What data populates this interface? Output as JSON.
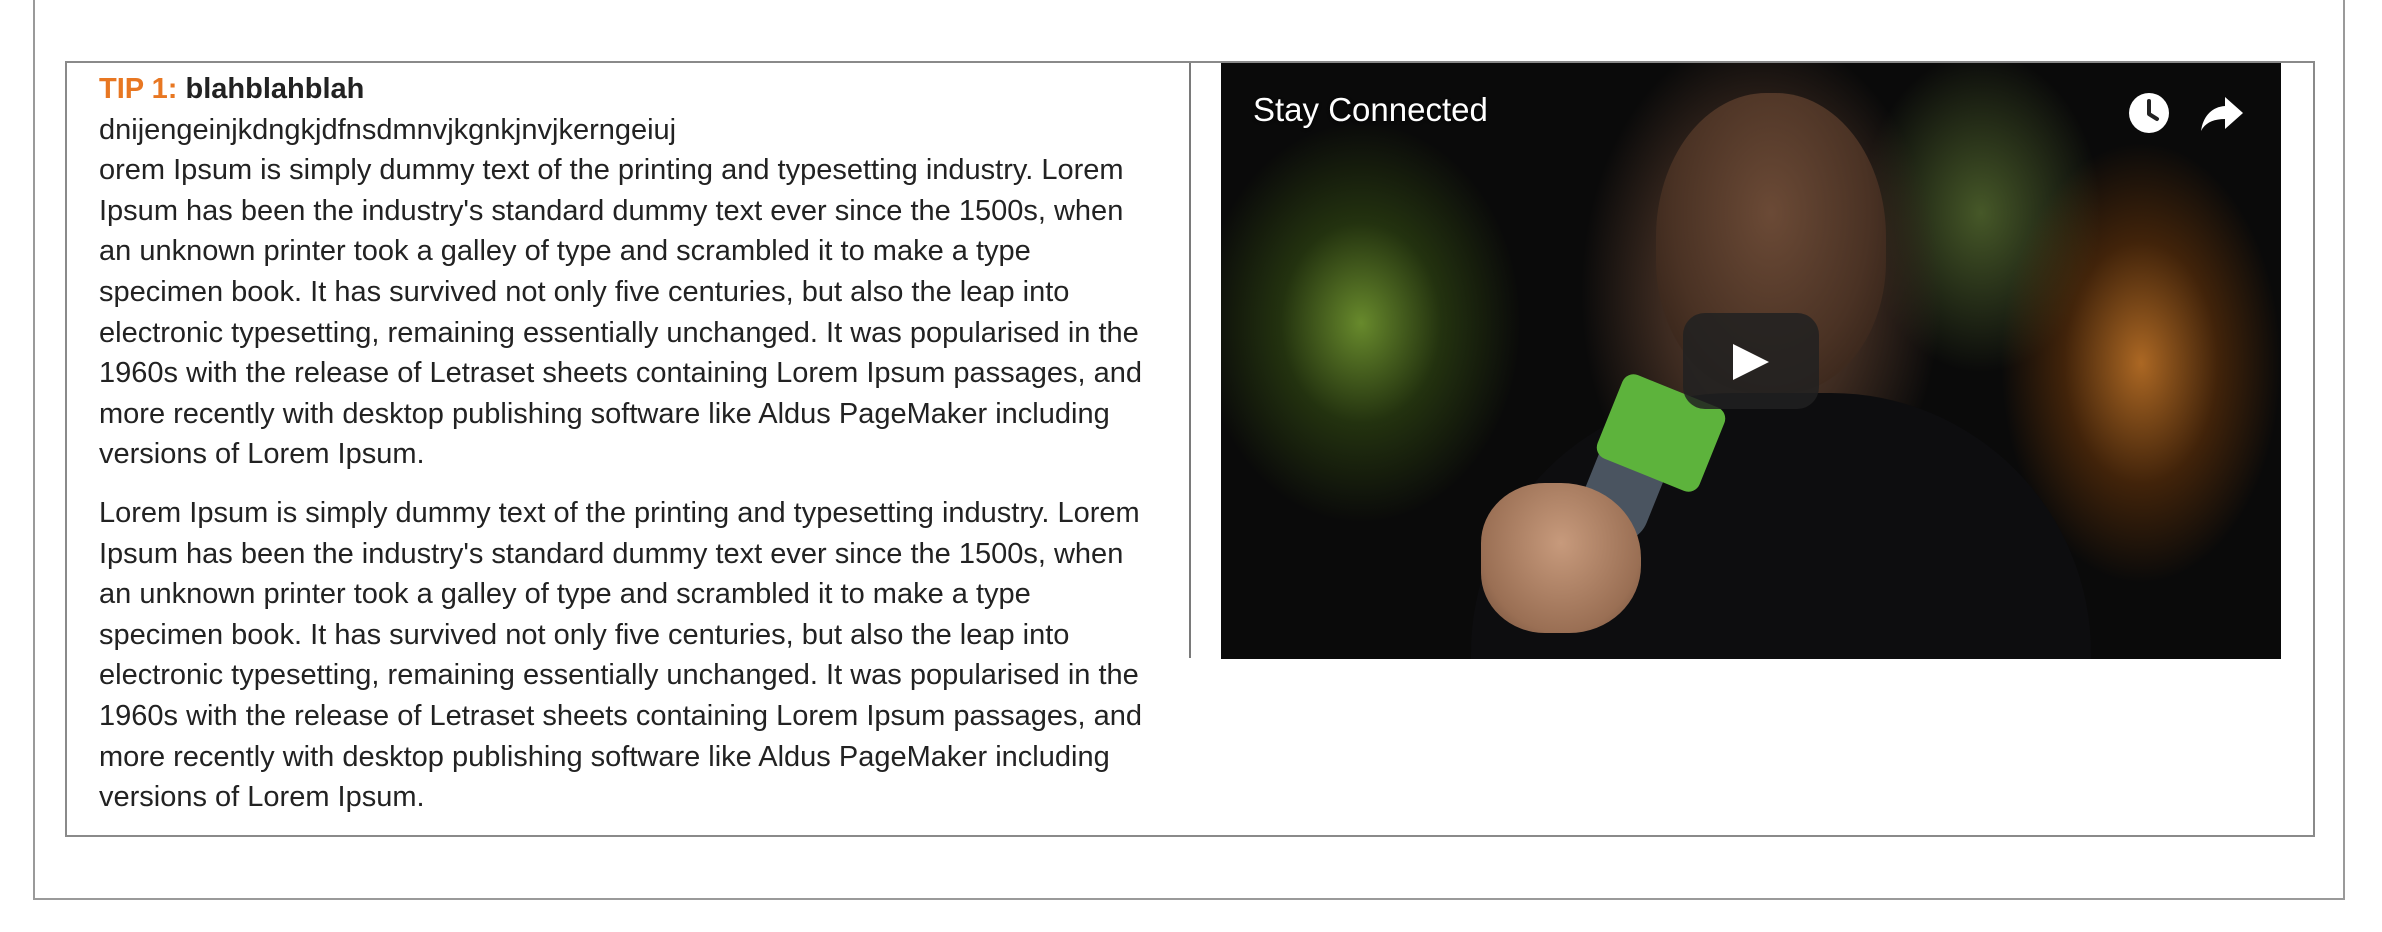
{
  "tip": {
    "label": "TIP 1:",
    "title": "blahblahblah",
    "subtitle": "dnijengeinjkdngkjdfnsdmnvjkgnkjnvjkerngeiuj",
    "paragraphs": [
      "orem Ipsum is simply dummy text of the printing and typesetting industry. Lorem Ipsum has been the industry's standard dummy text ever since the 1500s, when an unknown printer took a galley of type and scrambled it to make a type specimen book. It has survived not only five centuries, but also the leap into electronic typesetting, remaining essentially unchanged. It was popularised in the 1960s with the release of Letraset sheets containing Lorem Ipsum passages, and more recently with desktop publishing software like Aldus PageMaker including versions of Lorem Ipsum.",
      "Lorem Ipsum is simply dummy text of the printing and typesetting industry. Lorem Ipsum has been the industry's standard dummy text ever since the 1500s, when an unknown printer took a galley of type and scrambled it to make a type specimen book. It has survived not only five centuries, but also the leap into electronic typesetting, remaining essentially unchanged. It was popularised in the 1960s with the release of Letraset sheets containing Lorem Ipsum passages, and more recently with desktop publishing software like Aldus PageMaker including versions of Lorem Ipsum."
    ]
  },
  "video": {
    "title": "Stay Connected",
    "icons": {
      "watch_later": "clock-icon",
      "share": "share-arrow-icon",
      "play": "play-icon"
    }
  },
  "colors": {
    "tip_label": "#e87722",
    "text": "#222222",
    "border": "#8a8a8a"
  }
}
